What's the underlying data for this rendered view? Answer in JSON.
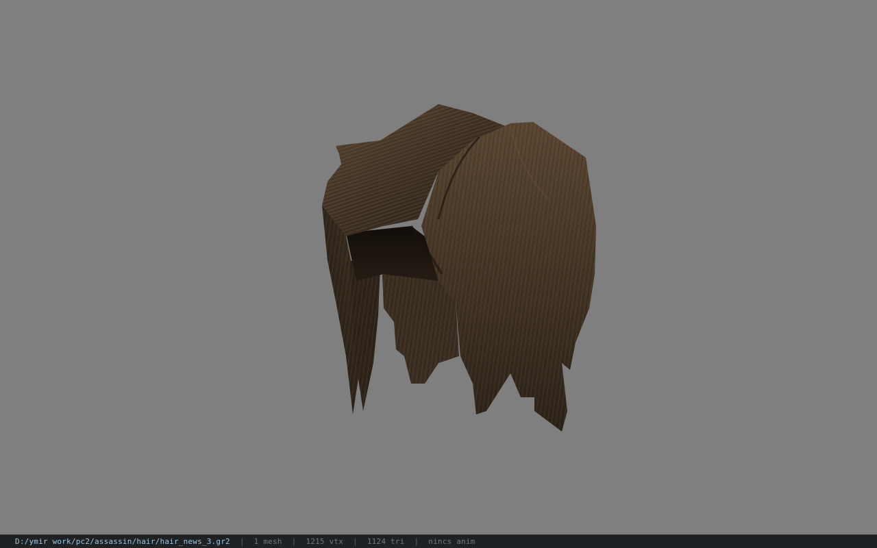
{
  "viewport": {
    "background_color": "#7f7f7f",
    "model_colors": {
      "hair_dark": "#2a2118",
      "hair_mid": "#4a3a2a",
      "hair_light": "#6a5540",
      "hair_shadow": "#1a140e"
    }
  },
  "status_bar": {
    "file_path": "D:/ymir work/pc2/assassin/hair/hair_news_3.gr2",
    "separator": "|",
    "mesh_count": "1 mesh",
    "vertex_count": "1215 vtx",
    "triangle_count": "1124 tri",
    "anim_status": "nincs anim",
    "path_color": "#9fc6df",
    "stat_color": "#6f7a82",
    "bar_color": "#1f2224"
  }
}
